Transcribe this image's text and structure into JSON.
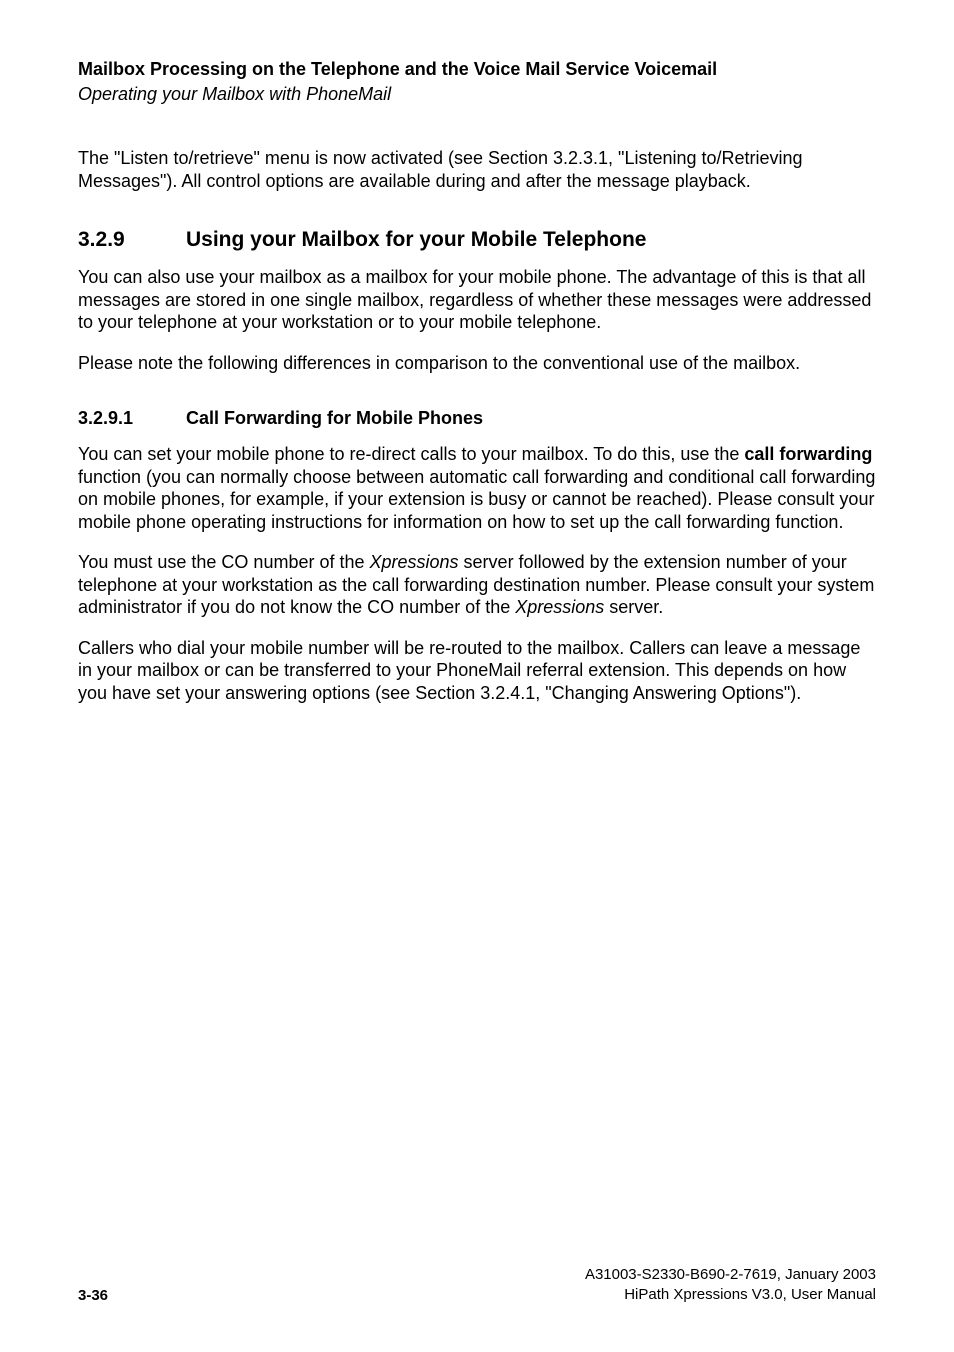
{
  "header": {
    "title_bold": "Mailbox Processing on the Telephone and the Voice Mail Service Voicemail",
    "title_italic": "Operating your Mailbox with PhoneMail"
  },
  "intro_paragraph": "The \"Listen to/retrieve\" menu is now activated (see Section 3.2.3.1, \"Listening to/Retrieving Messages\"). All control options are available during and after the message playback.",
  "section": {
    "number": "3.2.9",
    "title": "Using your Mailbox for your Mobile Telephone",
    "para1": "You can also use your mailbox as a mailbox for your mobile phone. The advantage of this is that all messages are stored in one single mailbox, regardless of whether these messages were addressed to your telephone at your workstation or to your mobile telephone.",
    "para2": "Please note the following differences in comparison to the conventional use of the mailbox."
  },
  "subsection": {
    "number": "3.2.9.1",
    "title": "Call Forwarding for Mobile Phones",
    "para1_pre": "You can set your mobile phone to re-direct calls to your mailbox. To do this, use the ",
    "para1_bold": "call forwarding",
    "para1_post": " function (you can normally choose between automatic call forwarding and conditional call forwarding on mobile phones, for example, if your extension is busy or cannot be reached). Please consult your mobile phone operating instructions for information on how to set up the call forwarding function.",
    "para2_pre": "You must use the CO number of the ",
    "para2_italic1": "Xpressions",
    "para2_mid": " server followed by the extension number of your telephone at your workstation as the call forwarding destination number. Please consult your system administrator if you do not know the CO number of the ",
    "para2_italic2": "Xpressions",
    "para2_post": " server.",
    "para3": "Callers who dial your mobile number will be re-routed to the mailbox. Callers can leave a message in your mailbox or can be transferred to your PhoneMail referral extension. This depends on how you have set your answering options (see Section 3.2.4.1, \"Changing Answering Options\")."
  },
  "footer": {
    "page": "3-36",
    "doc_id": "A31003-S2330-B690-2-7619, January 2003",
    "doc_title": "HiPath Xpressions V3.0, User Manual"
  }
}
